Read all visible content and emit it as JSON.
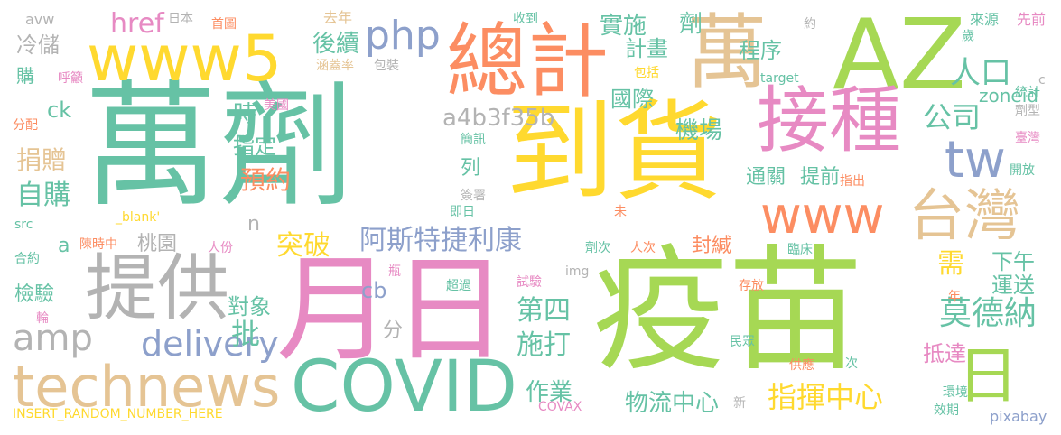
{
  "palette": {
    "green": "#66c2a5",
    "orange": "#fc8d62",
    "blue": "#8da0cb",
    "pink": "#e78ac3",
    "lime": "#a6d854",
    "yellow": "#ffd92f",
    "tan": "#e5c494",
    "gray": "#b3b3b3"
  },
  "words": [
    {
      "text": "萬劑"
    },
    {
      "text": "疫苗"
    },
    {
      "text": "到貨"
    },
    {
      "text": "月日"
    },
    {
      "text": "AZ"
    },
    {
      "text": "總計"
    },
    {
      "text": "萬"
    },
    {
      "text": "www5"
    },
    {
      "text": "接種"
    },
    {
      "text": "提供"
    },
    {
      "text": "COVID"
    },
    {
      "text": "technews"
    },
    {
      "text": "台灣"
    },
    {
      "text": "www"
    },
    {
      "text": "tw"
    },
    {
      "text": "日"
    },
    {
      "text": "amp"
    },
    {
      "text": "delivery"
    },
    {
      "text": "php"
    },
    {
      "text": "阿斯特捷利康"
    },
    {
      "text": "人口"
    },
    {
      "text": "公司"
    },
    {
      "text": "莫德納"
    },
    {
      "text": "指揮中心"
    },
    {
      "text": "a4b3f35b"
    },
    {
      "text": "突破"
    },
    {
      "text": "第四"
    },
    {
      "text": "施打"
    },
    {
      "text": "後續"
    },
    {
      "text": "實施"
    },
    {
      "text": "自購"
    },
    {
      "text": "捐贈"
    },
    {
      "text": "預約"
    },
    {
      "text": "需"
    },
    {
      "text": "下午"
    },
    {
      "text": "運送"
    },
    {
      "text": "抵達"
    },
    {
      "text": "物流中心"
    },
    {
      "text": "作業"
    },
    {
      "text": "國際"
    },
    {
      "text": "機場"
    },
    {
      "text": "通關"
    },
    {
      "text": "提前"
    },
    {
      "text": "封緘"
    },
    {
      "text": "對象"
    },
    {
      "text": "批"
    },
    {
      "text": "檢驗"
    },
    {
      "text": "桃園"
    },
    {
      "text": "指定"
    },
    {
      "text": "時"
    },
    {
      "text": "程序"
    },
    {
      "text": "計畫"
    },
    {
      "text": "劑"
    },
    {
      "text": "href"
    },
    {
      "text": "冷儲"
    },
    {
      "text": "購"
    },
    {
      "text": "ck"
    },
    {
      "text": "列"
    },
    {
      "text": "n"
    },
    {
      "text": "a"
    },
    {
      "text": "cb"
    },
    {
      "text": "分"
    },
    {
      "text": "zoneid"
    },
    {
      "text": "INSERT_RANDOM_NUMBER_HERE"
    },
    {
      "text": "pixabay"
    },
    {
      "text": "COVAX"
    },
    {
      "text": "_blank'"
    },
    {
      "text": "avw"
    },
    {
      "text": "日本"
    },
    {
      "text": "首圖"
    },
    {
      "text": "去年"
    },
    {
      "text": "收到"
    },
    {
      "text": "先前"
    },
    {
      "text": "來源"
    },
    {
      "text": "約"
    },
    {
      "text": "歲"
    },
    {
      "text": "c"
    },
    {
      "text": "統計"
    },
    {
      "text": "劑型"
    },
    {
      "text": "target"
    },
    {
      "text": "臺灣"
    },
    {
      "text": "開放"
    },
    {
      "text": "指出"
    },
    {
      "text": "呼籲"
    },
    {
      "text": "涵蓋率"
    },
    {
      "text": "包裝"
    },
    {
      "text": "包括"
    },
    {
      "text": "美國"
    },
    {
      "text": "分配"
    },
    {
      "text": "簡訊"
    },
    {
      "text": "簽署"
    },
    {
      "text": "即日"
    },
    {
      "text": "未"
    },
    {
      "text": "src"
    },
    {
      "text": "陳時中"
    },
    {
      "text": "人份"
    },
    {
      "text": "合約"
    },
    {
      "text": "劑次"
    },
    {
      "text": "人次"
    },
    {
      "text": "瓶"
    },
    {
      "text": "img"
    },
    {
      "text": "臨床"
    },
    {
      "text": "超過"
    },
    {
      "text": "試驗"
    },
    {
      "text": "存放"
    },
    {
      "text": "年"
    },
    {
      "text": "輪"
    },
    {
      "text": "民眾"
    },
    {
      "text": "供應"
    },
    {
      "text": "次"
    },
    {
      "text": "環境"
    },
    {
      "text": "效期"
    },
    {
      "text": "新"
    }
  ]
}
